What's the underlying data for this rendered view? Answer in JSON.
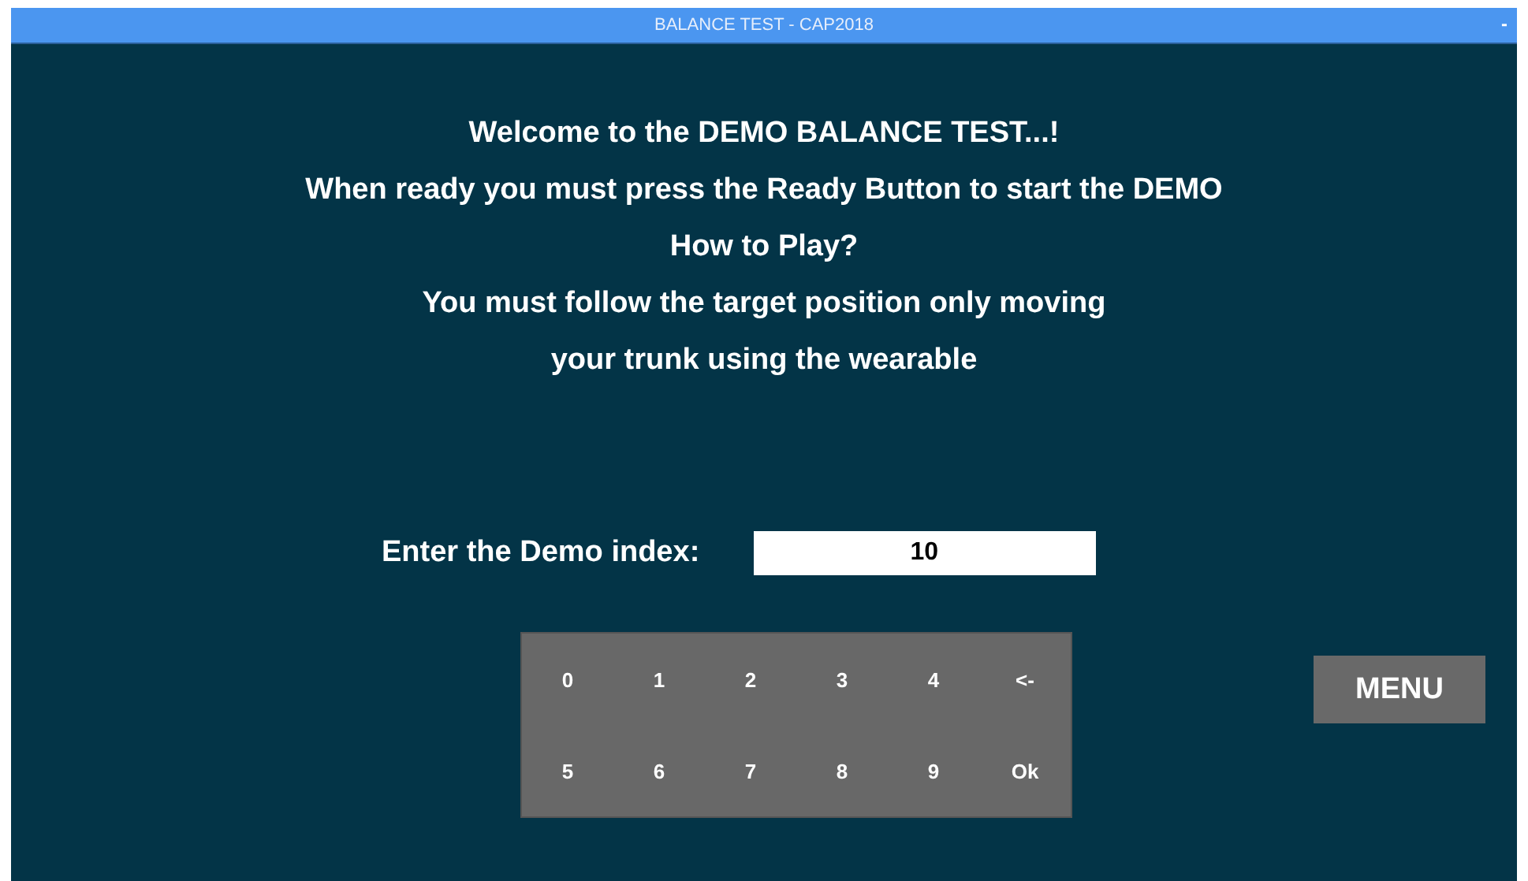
{
  "window": {
    "title": "BALANCE TEST - CAP2018",
    "minimize": "-"
  },
  "instructions": [
    "Welcome to the DEMO BALANCE TEST...!",
    "When ready you must press the Ready Button to start the DEMO",
    "How to Play?",
    "You must follow the target position only moving",
    "your trunk using the wearable"
  ],
  "demo_index": {
    "label": "Enter the Demo index:",
    "value": "10"
  },
  "keypad": [
    [
      "0",
      "1",
      "2",
      "3",
      "4",
      "<-"
    ],
    [
      "5",
      "6",
      "7",
      "8",
      "9",
      "Ok"
    ]
  ],
  "menu_button": "MENU"
}
